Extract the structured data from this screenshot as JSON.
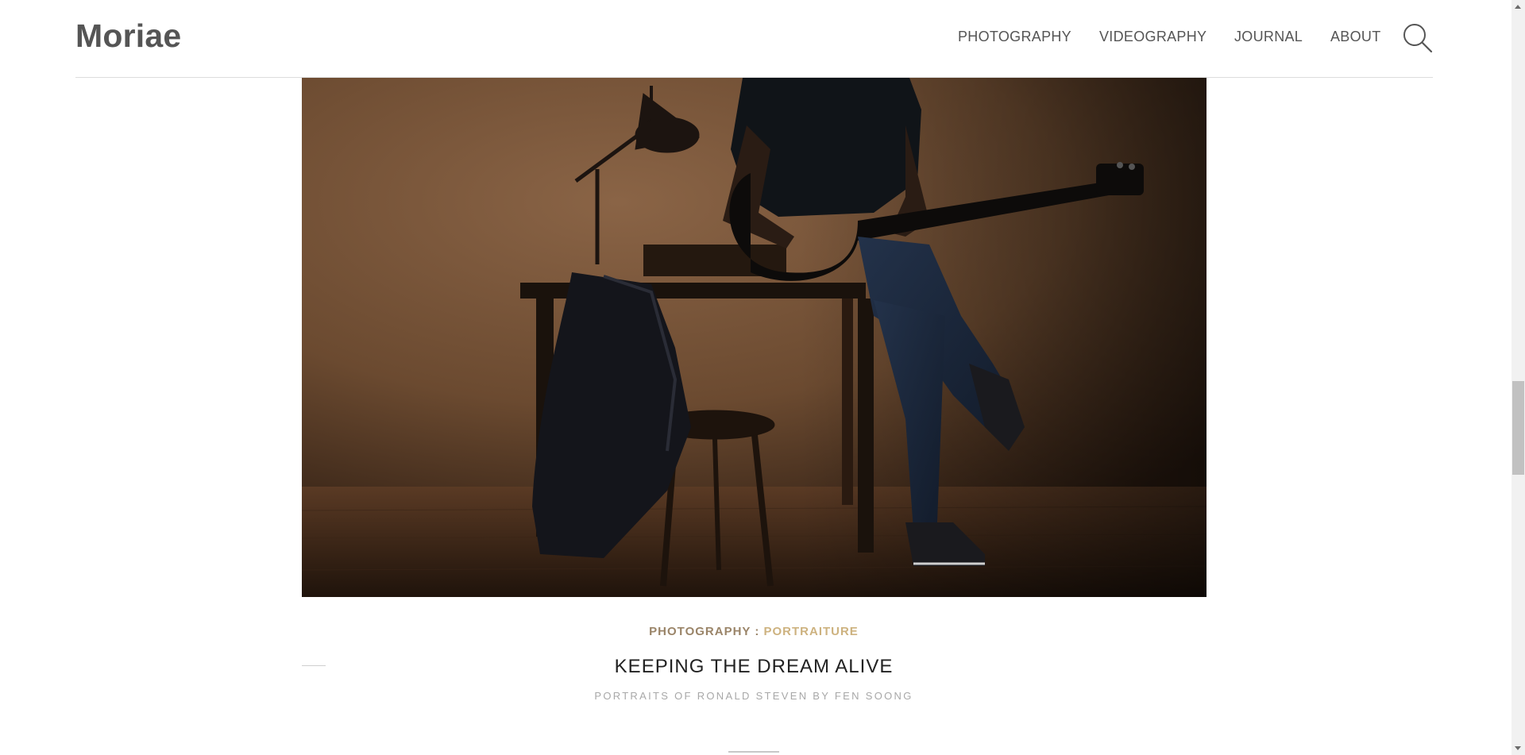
{
  "site": {
    "logo": "Moriae"
  },
  "nav": {
    "items": [
      {
        "label": "PHOTOGRAPHY"
      },
      {
        "label": "VIDEOGRAPHY"
      },
      {
        "label": "JOURNAL"
      },
      {
        "label": "ABOUT"
      }
    ],
    "search_icon": "search-icon"
  },
  "post": {
    "image_icon": "featured-image",
    "category_primary": "PHOTOGRAPHY",
    "category_separator": ":",
    "category_secondary": "PORTRAITURE",
    "title": "KEEPING THE DREAM ALIVE",
    "subtitle": "PORTRAITS OF RONALD STEVEN BY FEN SOONG"
  },
  "colors": {
    "category_primary": "#9a8468",
    "category_secondary": "#cdb27f",
    "logo": "#555555",
    "title": "#222222"
  }
}
